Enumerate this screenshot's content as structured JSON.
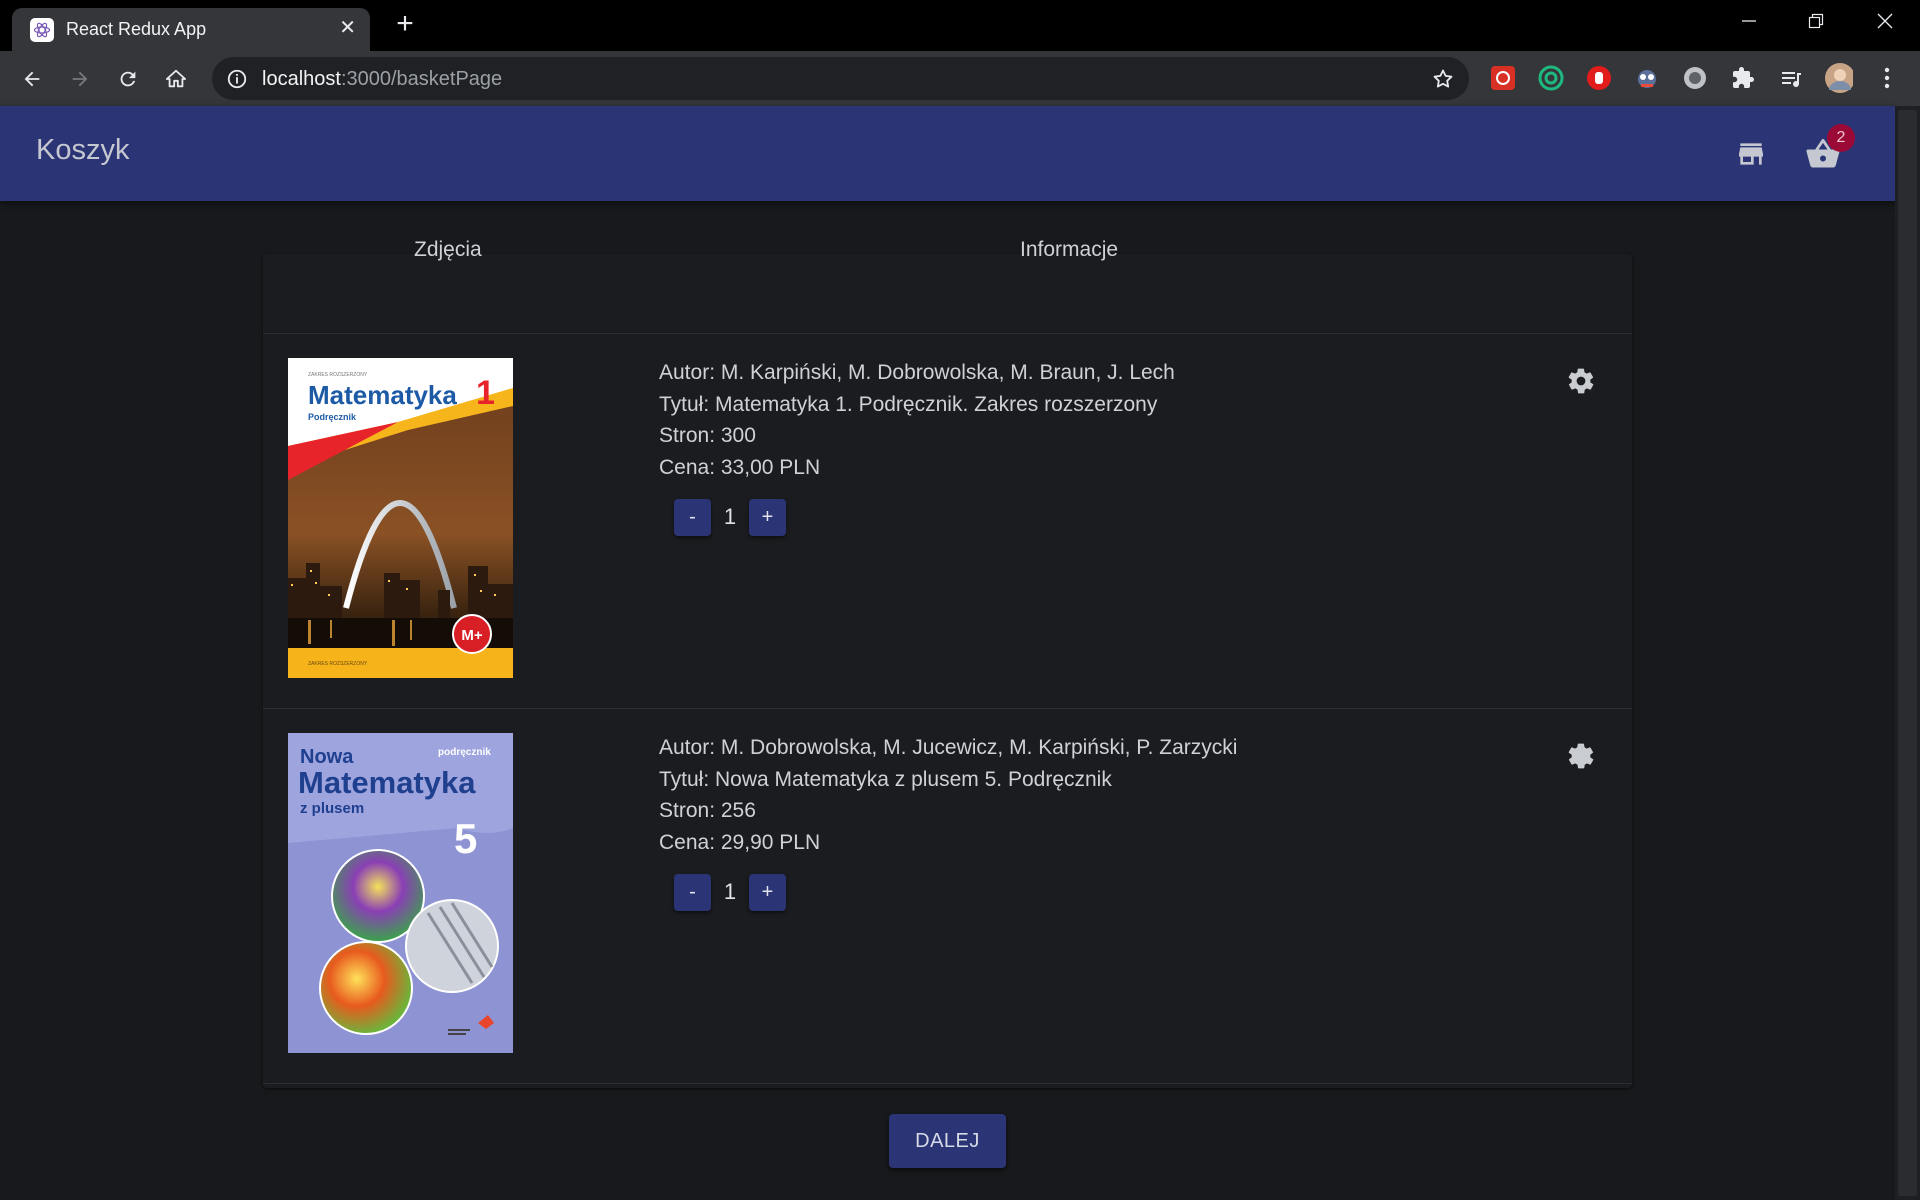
{
  "browser": {
    "tab_title": "React Redux App",
    "tab_close": "✕",
    "new_tab": "+",
    "url_host": "localhost",
    "url_path": ":3000/basketPage"
  },
  "app": {
    "title": "Koszyk",
    "basket_count": "2"
  },
  "table": {
    "col_images": "Zdjęcia",
    "col_info": "Informacje"
  },
  "items": [
    {
      "cover": {
        "top_small": "ZAKRES ROZSZERZONY",
        "title": "Matematyka",
        "number": "1",
        "subtitle": "Podręcznik",
        "bottom_small": "ZAKRES ROZSZERZONY"
      },
      "author": "Autor: M. Karpiński, M. Dobrowolska, M. Braun, J. Lech",
      "title": "Tytuł: Matematyka 1. Podręcznik. Zakres rozszerzony",
      "pages": "Stron: 300",
      "price": "Cena: 33,00 PLN",
      "minus": "-",
      "quantity": "1",
      "plus": "+"
    },
    {
      "cover": {
        "line1": "Nowa",
        "title": "Matematyka",
        "line3": "z plusem",
        "tag": "podręcznik",
        "number": "5"
      },
      "author": "Autor: M. Dobrowolska, M. Jucewicz, M. Karpiński, P. Zarzycki",
      "title": "Tytuł: Nowa Matematyka z plusem 5. Podręcznik",
      "pages": "Stron: 256",
      "price": "Cena: 29,90 PLN",
      "minus": "-",
      "quantity": "1",
      "plus": "+"
    }
  ],
  "next_label": "DALEJ",
  "colors": {
    "appbar": "#2b3475",
    "badge": "#9b0a37",
    "background": "#18191c"
  }
}
